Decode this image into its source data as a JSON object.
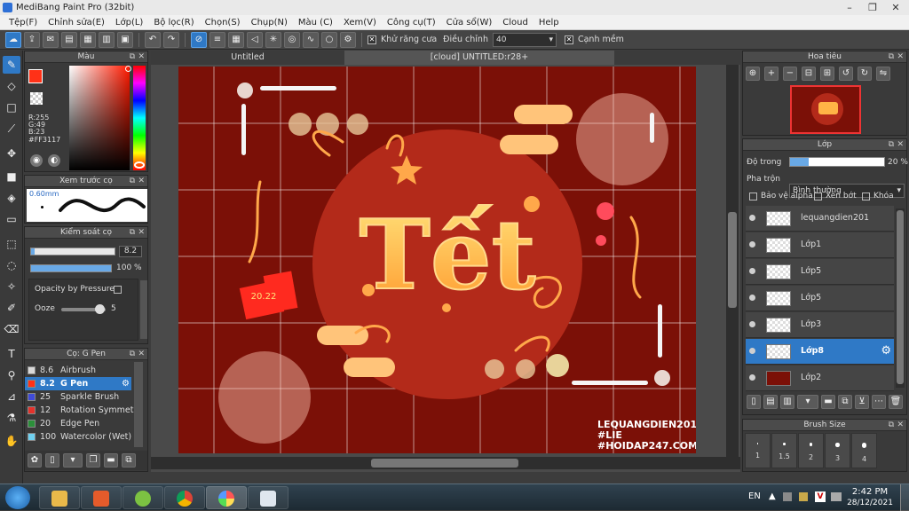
{
  "window": {
    "title": "MediBang Paint Pro (32bit)"
  },
  "menu": [
    "Tệp(F)",
    "Chỉnh sửa(E)",
    "Lớp(L)",
    "Bộ lọc(R)",
    "Chọn(S)",
    "Chụp(N)",
    "Màu (C)",
    "Xem(V)",
    "Công cụ(T)",
    "Cửa sổ(W)",
    "Cloud",
    "Help"
  ],
  "toolbar": {
    "antialias_label": "Khử răng cưa",
    "correction_label": "Điều chỉnh",
    "correction_value": "40",
    "edge_label": "Cạnh mềm"
  },
  "color_panel": {
    "title": "Màu",
    "r": "R:255",
    "g": "G:49",
    "b": "B:23",
    "hex": "#FF3117",
    "fg_color": "#ff3117"
  },
  "brush_preview": {
    "title": "Xem trước cọ",
    "size": "0.60mm"
  },
  "brush_control": {
    "title": "Kiểm soát cọ",
    "size_value": "8.2",
    "opacity_value": "100 %",
    "opacity_pressure_label": "Opacity by Pressure",
    "ooze_label": "Ooze",
    "ooze_value": "5"
  },
  "brush_list": {
    "title": "Cọ: G Pen",
    "items": [
      {
        "num": "8.6",
        "name": "Airbrush",
        "color": "#d9d9d9"
      },
      {
        "num": "8.2",
        "name": "G Pen",
        "color": "#ff3117"
      },
      {
        "num": "25",
        "name": "Sparkle Brush",
        "color": "#3f4bd8"
      },
      {
        "num": "12",
        "name": "Rotation Symmetry",
        "color": "#e5322b"
      },
      {
        "num": "20",
        "name": "Edge Pen",
        "color": "#2b8f3a"
      },
      {
        "num": "100",
        "name": "Watercolor (Wet)",
        "color": "#6fd0f0"
      }
    ]
  },
  "tabs": [
    "Untitled",
    "[cloud] UNTITLED:r28+"
  ],
  "navigator": {
    "title": "Hoa tiêu"
  },
  "layer_panel": {
    "title": "Lớp",
    "opacity_label": "Độ trong",
    "opacity_value": "20 %",
    "opacity_fraction": 0.2,
    "blend_label": "Pha trộn",
    "blend_value": "Bình thường",
    "protect_alpha": "Bảo vệ alpha",
    "clip": "Xén bớt",
    "lock": "Khóa",
    "layers": [
      {
        "name": "lequangdien201",
        "selected": false
      },
      {
        "name": "Lớp1",
        "selected": false
      },
      {
        "name": "Lớp5",
        "selected": false
      },
      {
        "name": "Lớp5",
        "selected": false
      },
      {
        "name": "Lớp3",
        "selected": false
      },
      {
        "name": "Lớp8",
        "selected": true
      },
      {
        "name": "Lớp2",
        "selected": false
      }
    ]
  },
  "brush_size": {
    "title": "Brush Size",
    "sizes": [
      "1",
      "1.5",
      "2",
      "3",
      "4"
    ]
  },
  "artwork": {
    "title_text": "Tết",
    "badge_text": "20.22",
    "watermark": [
      "LEQUANGDIEN201",
      "#LIE",
      "#HOIDAP247.COM"
    ],
    "bg_color": "#7b1007",
    "circle_color": "#b32a1a",
    "accent_color": "#ffb446"
  },
  "taskbar": {
    "language": "EN",
    "time": "2:42 PM",
    "date": "28/12/2021"
  }
}
